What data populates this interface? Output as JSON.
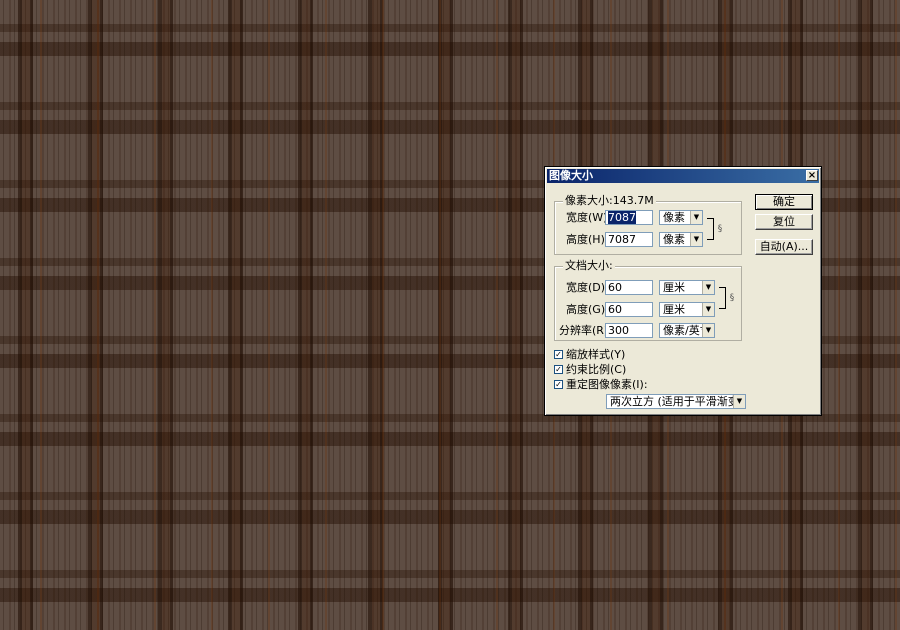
{
  "dialog": {
    "title": "图像大小",
    "close_glyph": "×"
  },
  "pixel_dimensions": {
    "group_label": "像素大小:143.7M",
    "width_label": "宽度(W):",
    "width_value": "7087",
    "width_unit": "像素",
    "height_label": "高度(H):",
    "height_value": "7087",
    "height_unit": "像素"
  },
  "document_size": {
    "group_label": "文档大小:",
    "width_label": "宽度(D):",
    "width_value": "60",
    "width_unit": "厘米",
    "height_label": "高度(G):",
    "height_value": "60",
    "height_unit": "厘米",
    "resolution_label": "分辨率(R):",
    "resolution_value": "300",
    "resolution_unit": "像素/英寸"
  },
  "options": {
    "scale_styles_label": "缩放样式(Y)",
    "scale_styles_checked": true,
    "constrain_label": "约束比例(C)",
    "constrain_checked": true,
    "resample_label": "重定图像像素(I):",
    "resample_checked": true,
    "resample_method": "两次立方 (适用于平滑渐变)"
  },
  "buttons": {
    "ok": "确定",
    "reset": "复位",
    "auto": "自动(A)..."
  },
  "icons": {
    "link": "chain-link-icon",
    "dropdown": "chevron-down-icon",
    "check": "checkmark-icon"
  },
  "glyphs": {
    "arrow": "▼",
    "check": "✓",
    "link": "§"
  },
  "colors": {
    "dialog_bg": "#ece9d8",
    "title_bg": "#0a246a",
    "selection_bg": "#0a246a",
    "canvas_bg": "#5e4d43"
  }
}
